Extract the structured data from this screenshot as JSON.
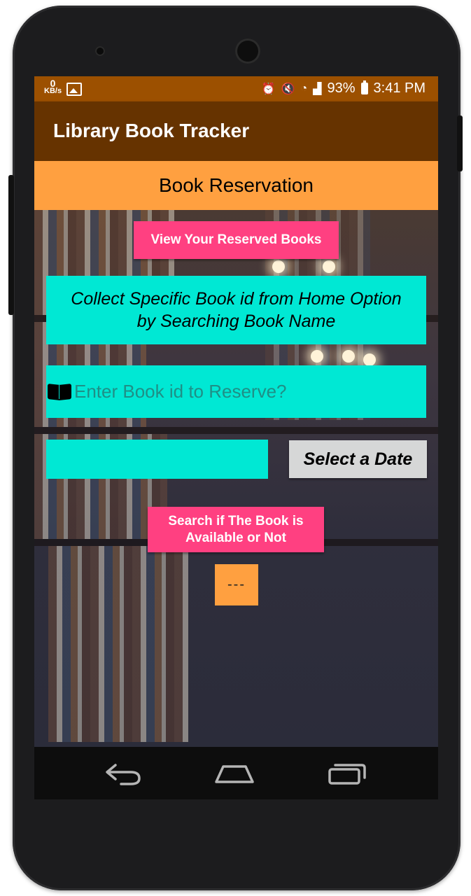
{
  "status_bar": {
    "speed_value": "0",
    "speed_unit": "KB/s",
    "battery": "93%",
    "time": "3:41 PM",
    "icons": [
      "image-icon",
      "alarm-icon",
      "mute-icon",
      "wifi-icon",
      "signal-icon",
      "battery-icon"
    ]
  },
  "app_bar": {
    "title": "Library Book Tracker"
  },
  "header": {
    "title": "Book Reservation"
  },
  "main": {
    "view_reserved_button": "View Your Reserved Books",
    "info_text": "Collect Specific Book id from Home Option by Searching Book Name",
    "book_id_input": {
      "value": "",
      "placeholder": "Enter Book id to Reserve?"
    },
    "date_field": {
      "value": ""
    },
    "select_date_button": "Select a Date",
    "search_button": "Search if The Book is Available or Not",
    "result_text": "---"
  },
  "nav_bar": {
    "icons": [
      "back-icon",
      "home-icon",
      "recents-icon"
    ]
  },
  "colors": {
    "status_bar": "#9c5000",
    "app_bar": "#663300",
    "header_band": "#ffa040",
    "accent_pink": "#ff4081",
    "cyan": "#00e8d4",
    "date_button": "#d6d7d7"
  }
}
